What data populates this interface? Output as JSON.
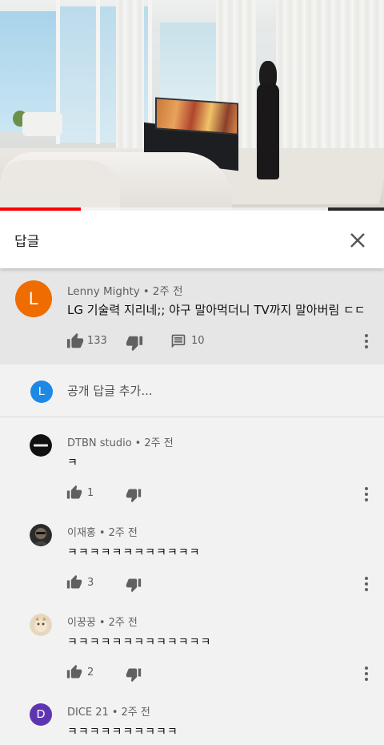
{
  "header": {
    "title": "답글"
  },
  "parent_comment": {
    "avatar_letter": "L",
    "avatar_color": "#ef6c00",
    "author": "Lenny Mighty",
    "time": "2주 전",
    "text": "LG 기술력 지리네;; 야구 말아먹더니 TV까지 말아버림 ㄷㄷ",
    "likes": "133",
    "replies": "10"
  },
  "add_reply": {
    "avatar_letter": "L",
    "placeholder": "공개 답글 추가..."
  },
  "replies": [
    {
      "author": "DTBN studio",
      "time": "2주 전",
      "text": "ㅋ",
      "likes": "1"
    },
    {
      "author": "이재홍",
      "time": "2주 전",
      "text": "ㅋㅋㅋㅋㅋㅋㅋㅋㅋㅋㅋㅋ",
      "likes": "3"
    },
    {
      "author": "이꿍꿍",
      "time": "2주 전",
      "text": "ㅋㅋㅋㅋㅋㅋㅋㅋㅋㅋㅋㅋㅋ",
      "likes": "2"
    },
    {
      "author": "DICE 21",
      "time": "2주 전",
      "text": "ㅋㅋㅋㅋㅋㅋㅋㅋㅋㅋ",
      "avatar_letter": "D",
      "avatar_color": "#5e35b1"
    }
  ],
  "video": {
    "progress_fraction": 0.21
  },
  "colors": {
    "accent": "#ff0000",
    "meta": "#606060",
    "parent_bg": "#e6e6e6",
    "page_bg": "#f2f2f2"
  },
  "icons": [
    "close-icon",
    "like-icon",
    "dislike-icon",
    "reply-icon",
    "more-icon"
  ]
}
